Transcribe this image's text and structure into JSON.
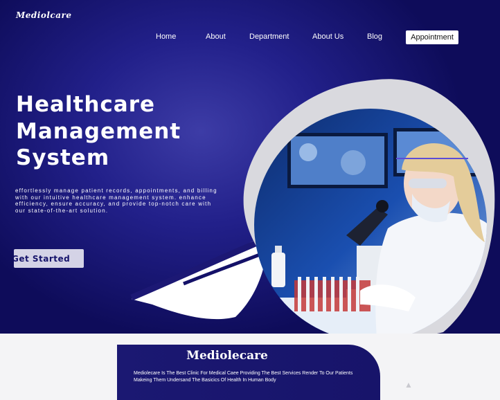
{
  "brand": {
    "logo": "Mediolcare"
  },
  "nav": {
    "items": [
      "Home",
      "About",
      "Department",
      "About Us",
      "Blog"
    ],
    "appointment": "Appointment"
  },
  "hero": {
    "title_lines": [
      "Healthcare",
      "Management",
      "System"
    ],
    "description": "effortlessly manage patient records, appointments, and billing with our intuitive healthcare management system. enhance efficiency, ensure accuracy, and provide top-notch care with our state-of-the-art solution.",
    "cta": "Get Started"
  },
  "about": {
    "heading": "Mediolecare",
    "text": "Mediolecare Is The Best Clinic For Medical Caee Providing The Best Services Render To Our Patients Makeing Them Undersand The Basicics Of Health In Human Body"
  },
  "colors": {
    "hero_bg": "#22208a",
    "hero_dark": "#0e0c5a",
    "button_bg": "#d4d3e6",
    "card_bg": "#1b1872",
    "page_bg": "#f4f4f6"
  }
}
